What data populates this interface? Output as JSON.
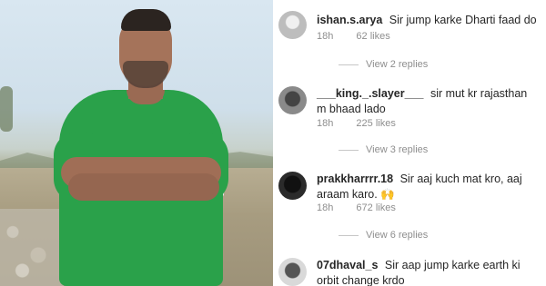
{
  "comments": [
    {
      "username": "ishan.s.arya",
      "text": "Sir jump karke Dharti faad do",
      "time": "18h",
      "likes": "62 likes",
      "replies": "View 2 replies"
    },
    {
      "username": "___king._.slayer___",
      "text": "sir mut kr rajasthan m bhaad lado",
      "time": "18h",
      "likes": "225 likes",
      "replies": "View 3 replies"
    },
    {
      "username": "prakkharrrr.18",
      "text": "Sir aaj kuch mat kro, aaj araam karo.",
      "emoji": "🙌",
      "time": "18h",
      "likes": "672 likes",
      "replies": "View 6 replies"
    },
    {
      "username": "07dhaval_s",
      "text": "Sir aap jump karke earth ki orbit change krdo"
    }
  ]
}
